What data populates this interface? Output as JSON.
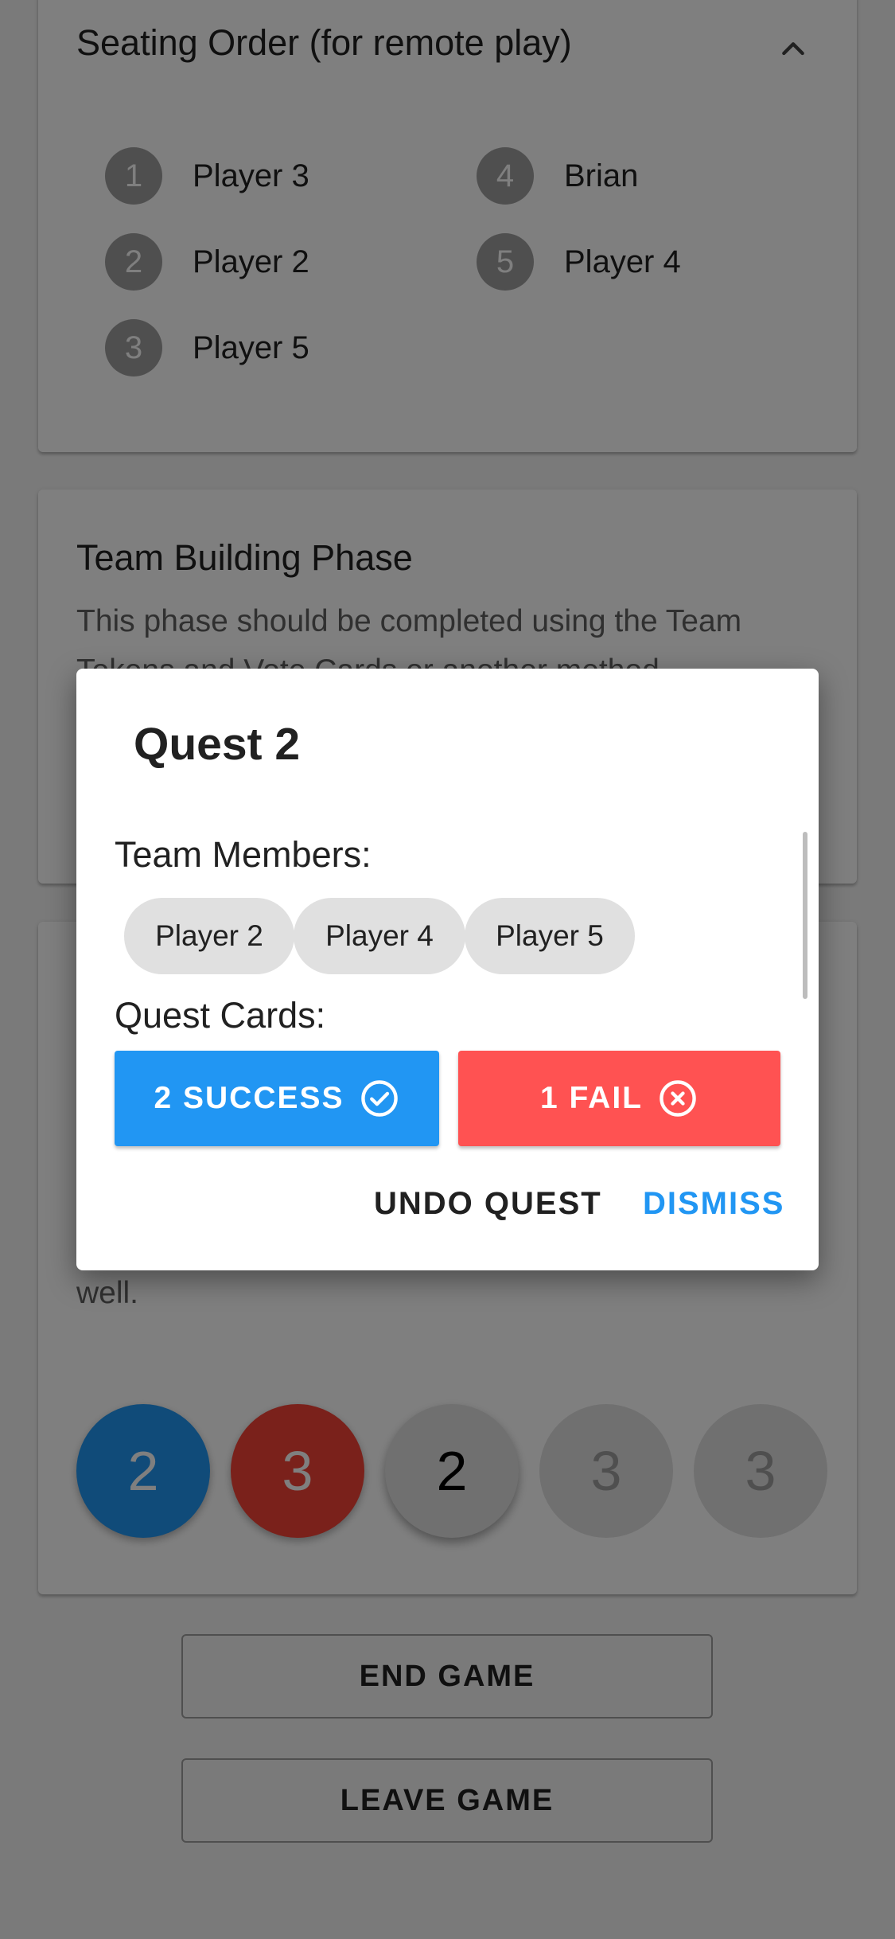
{
  "seating": {
    "title": "Seating Order (for remote play)",
    "players": [
      {
        "num": "1",
        "name": "Player 3"
      },
      {
        "num": "2",
        "name": "Player 2"
      },
      {
        "num": "3",
        "name": "Player 5"
      },
      {
        "num": "4",
        "name": "Brian"
      },
      {
        "num": "5",
        "name": "Player 4"
      }
    ]
  },
  "team_phase": {
    "title": "Team Building Phase",
    "description": "This phase should be completed using the Team Tokens and Vote Cards or another method."
  },
  "quest_phase": {
    "description_tail": "well.",
    "quests": [
      {
        "size": "2",
        "state": "success"
      },
      {
        "size": "3",
        "state": "fail"
      },
      {
        "size": "2",
        "state": "current"
      },
      {
        "size": "3",
        "state": "future"
      },
      {
        "size": "3",
        "state": "future"
      }
    ]
  },
  "buttons": {
    "end_game": "END GAME",
    "leave_game": "LEAVE GAME"
  },
  "dialog": {
    "title": "Quest 2",
    "team_label": "Team Members:",
    "team_members": [
      "Player 2",
      "Player 4",
      "Player 5"
    ],
    "cards_label": "Quest Cards:",
    "success_label": "2 SUCCESS",
    "fail_label": "1 FAIL",
    "undo_label": "UNDO QUEST",
    "dismiss_label": "DISMISS"
  },
  "colors": {
    "success": "#2196f3",
    "fail": "#ff5252",
    "fail_circle": "#f44336",
    "accent_text": "#2196f3",
    "scrim": "rgba(0,0,0,0.5)"
  },
  "icons": {
    "collapse": "chevron-up-icon",
    "success": "check-circle-icon",
    "fail": "close-circle-icon"
  }
}
